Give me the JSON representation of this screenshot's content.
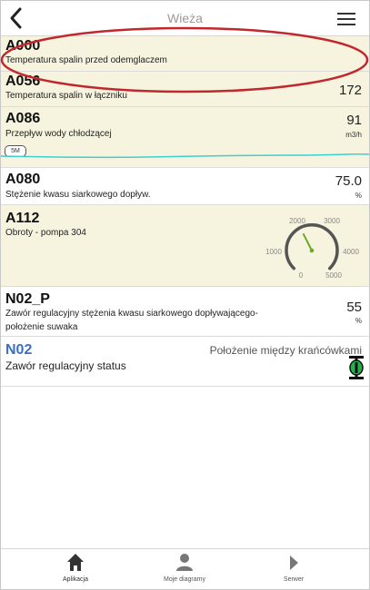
{
  "header": {
    "title": "Wieża"
  },
  "rows": [
    {
      "code": "A000",
      "description": "Temperatura spalin przed odemglaczem",
      "value": "",
      "unit": ""
    },
    {
      "code": "A056",
      "description": "Temperatura spalin w łączniku",
      "value": "172",
      "unit": ""
    },
    {
      "code": "A086",
      "description": "Przepływ wody chłodzącej",
      "value": "91",
      "unit": "m3/h",
      "badge": "5M"
    },
    {
      "code": "A080",
      "description": "Stężenie kwasu siarkowego dopływ.",
      "value": "75.0",
      "unit": "%"
    },
    {
      "code": "A112",
      "description": "Obroty - pompa 304",
      "gauge": {
        "labels": [
          "0",
          "1000",
          "2000",
          "3000",
          "4000",
          "5000"
        ],
        "value": 2000
      }
    },
    {
      "code": "N02_P",
      "description_line1": "Zawór regulacyjny stężenia kwasu siarkowego dopływającego-",
      "description_line2": "położenie suwaka",
      "value": "55",
      "unit": "%"
    },
    {
      "code": "N02",
      "description": "Zawór regulacyjny status",
      "status_text": "Położenie między krańcówkami"
    }
  ],
  "colors": {
    "accent_blue": "#3b6fc7",
    "highlight_ring": "#c0282d",
    "trend_line": "#3ecfd0",
    "gauge_needle": "#6aaa2a",
    "valve_green": "#22b14c",
    "beige_row": "#f6f4df"
  },
  "bottom_nav": [
    {
      "label": "Aplikacja",
      "icon": "home-icon"
    },
    {
      "label": "Moje diagramy",
      "icon": "user-icon"
    },
    {
      "label": "Serwer",
      "icon": "play-icon"
    }
  ]
}
